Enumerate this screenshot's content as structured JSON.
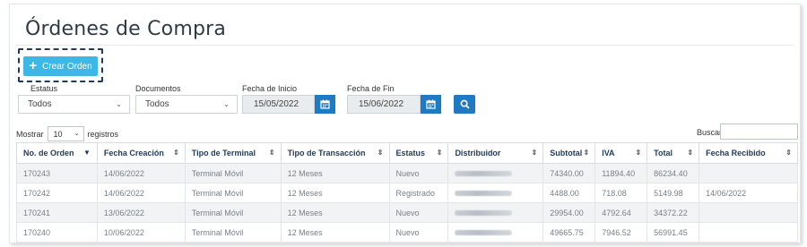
{
  "page": {
    "title": "Órdenes de Compra"
  },
  "toolbar": {
    "new_order_label": "Crear Orden",
    "new_order_icon": "plus-icon"
  },
  "filters": {
    "status": {
      "label": "Estatus",
      "value": "Todos"
    },
    "documents": {
      "label": "Documentos",
      "value": "Todos"
    },
    "start_date": {
      "label": "Fecha de Inicio",
      "value": "15/05/2022"
    },
    "end_date": {
      "label": "Fecha de Fin",
      "value": "15/06/2022"
    },
    "search_icon": "search-icon",
    "calendar_icon": "calendar-icon"
  },
  "table_controls": {
    "show_label": "Mostrar",
    "page_length": "10",
    "records_label": "registros",
    "search_label": "Buscar:",
    "search_value": ""
  },
  "table": {
    "columns": [
      "No. de Orden",
      "Fecha Creación",
      "Tipo de Terminal",
      "Tipo de Transacción",
      "Estatus",
      "Distribuidor",
      "Subtotal",
      "IVA",
      "Total",
      "Fecha Recibido"
    ],
    "rows": [
      [
        "170243",
        "14/06/2022",
        "Terminal Móvil",
        "12 Meses",
        "Nuevo",
        "",
        "74340.00",
        "11894.40",
        "86234.40",
        ""
      ],
      [
        "170242",
        "14/06/2022",
        "Terminal Móvil",
        "12 Meses",
        "Registrado",
        "",
        "4488.00",
        "718.08",
        "5149.98",
        "14/06/2022"
      ],
      [
        "170241",
        "13/06/2022",
        "Terminal Móvil",
        "12 Meses",
        "Nuevo",
        "",
        "29954.00",
        "4792.64",
        "34372.22",
        ""
      ],
      [
        "170240",
        "10/06/2022",
        "Terminal Móvil",
        "12 Meses",
        "Nuevo",
        "",
        "49665.75",
        "7946.52",
        "56991.45",
        ""
      ]
    ]
  },
  "colors": {
    "primary_button": "#3cb7e6",
    "icon_button": "#1f7ac4",
    "header_text": "#1f3a5c",
    "stripe": "#f2f3f5"
  }
}
